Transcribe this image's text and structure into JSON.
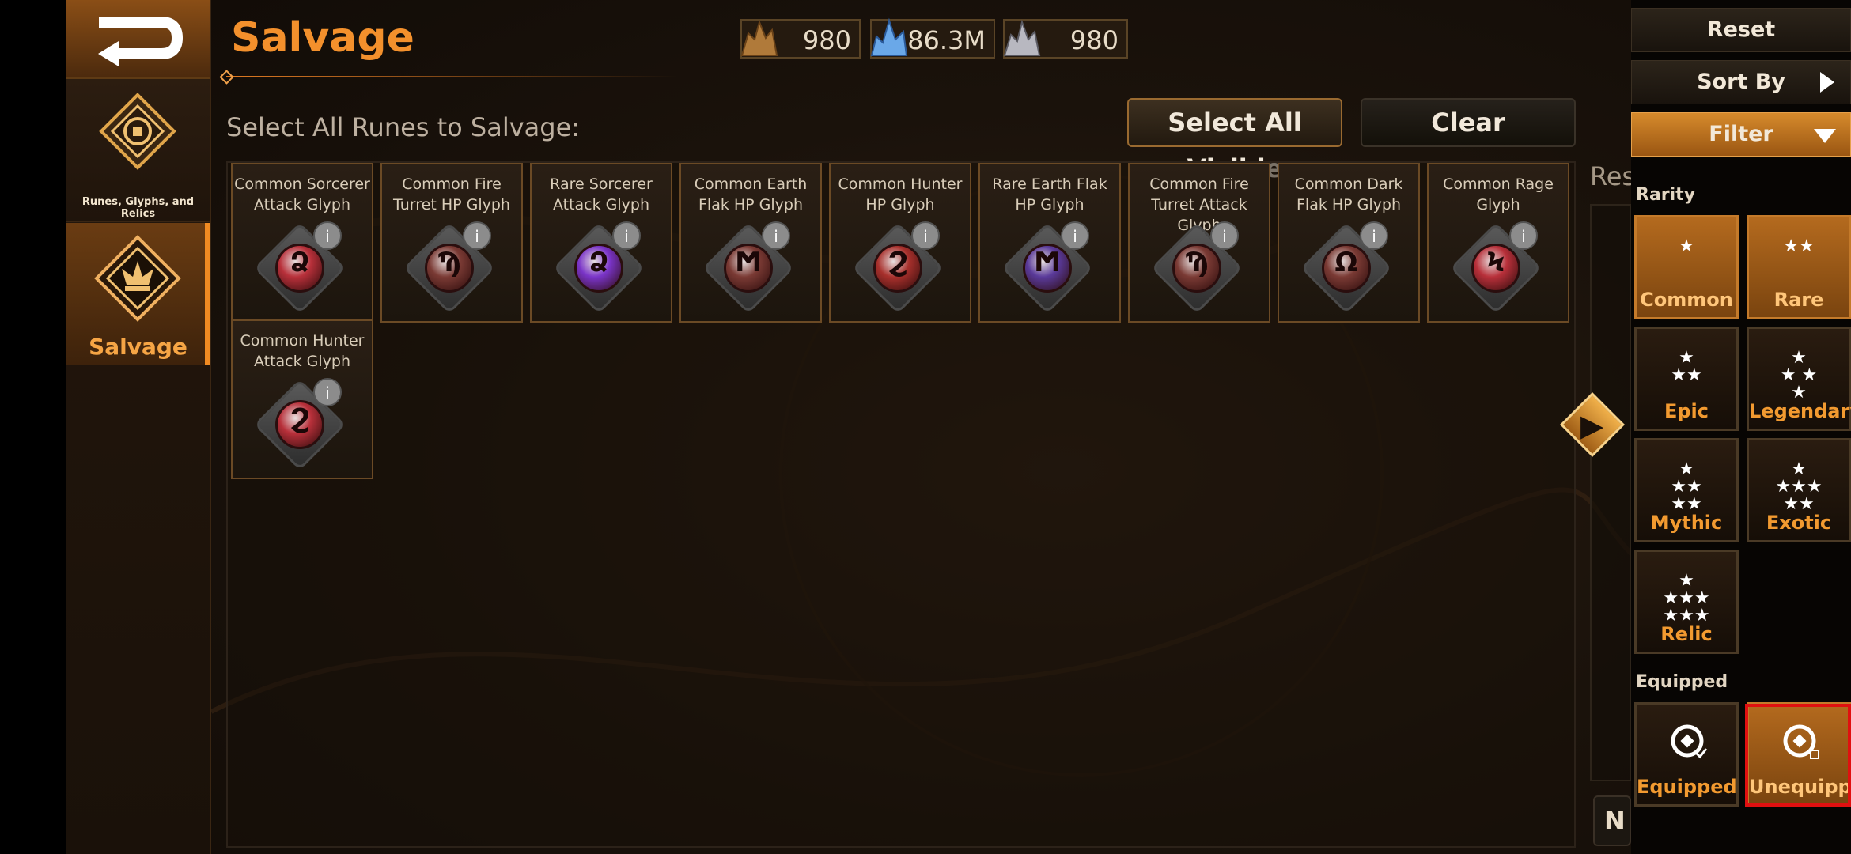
{
  "header": {
    "title": "Salvage",
    "resources": [
      {
        "icon": "copper-ore-icon",
        "value": "980"
      },
      {
        "icon": "blue-crystal-icon",
        "value": "86.3M"
      },
      {
        "icon": "silver-ore-icon",
        "value": "980"
      }
    ]
  },
  "sidebar": {
    "items": [
      {
        "label": "Runes, Glyphs, and Relics"
      },
      {
        "label": "Salvage"
      }
    ]
  },
  "main": {
    "select_label": "Select All Runes to Salvage:",
    "select_all_label": "Select All Visible",
    "clear_label": "Clear",
    "items": [
      {
        "name": "Common Sorcerer\nAttack Glyph",
        "color": "#b8303a",
        "glyph": "Ձ"
      },
      {
        "name": "Common Fire\nTurret HP Glyph",
        "color": "#7a3a34",
        "glyph": "Ϡ"
      },
      {
        "name": "Rare Sorcerer\nAttack Glyph",
        "color": "#7a34c8",
        "glyph": "Ձ"
      },
      {
        "name": "Common Earth\nFlak HP Glyph",
        "color": "#7a3a34",
        "glyph": "Ϻ"
      },
      {
        "name": "Common Hunter\nHP Glyph",
        "color": "#a8302c",
        "glyph": "Ϩ"
      },
      {
        "name": "Rare Earth Flak\nHP Glyph",
        "color": "#5a3a9a",
        "glyph": "Ϻ"
      },
      {
        "name": "Common Fire\nTurret Attack Glyph",
        "color": "#7a3a34",
        "glyph": "Ϡ"
      },
      {
        "name": "Common Dark\nFlak HP Glyph",
        "color": "#7a3a34",
        "glyph": "Ω"
      },
      {
        "name": "Common Rage\nGlyph",
        "color": "#b8303a",
        "glyph": "Ϟ"
      },
      {
        "name": "Common Hunter\nAttack Glyph",
        "color": "#b8303a",
        "glyph": "Ϩ"
      }
    ],
    "result_label": "Res",
    "next_label": "N"
  },
  "panel": {
    "reset_label": "Reset",
    "sort_label": "Sort By",
    "filter_label": "Filter",
    "rarity_label": "Rarity",
    "rarity_options": [
      {
        "label": "Common",
        "stars": "★"
      },
      {
        "label": "Rare",
        "stars": "★★"
      },
      {
        "label": "Epic",
        "stars": "★\n★★"
      },
      {
        "label": "Legendary",
        "stars": "★\n★ ★\n★"
      },
      {
        "label": "Mythic",
        "stars": "★\n★★\n★★"
      },
      {
        "label": "Exotic",
        "stars": "★\n★★★\n★★"
      },
      {
        "label": "Relic",
        "stars": "★\n★★★\n★★★"
      }
    ],
    "equipped_label": "Equipped",
    "equip_options": [
      {
        "label": "Equipped"
      },
      {
        "label": "Unequipped"
      }
    ]
  },
  "colors": {
    "accent": "#f3902c",
    "highlight": "#e01010"
  }
}
